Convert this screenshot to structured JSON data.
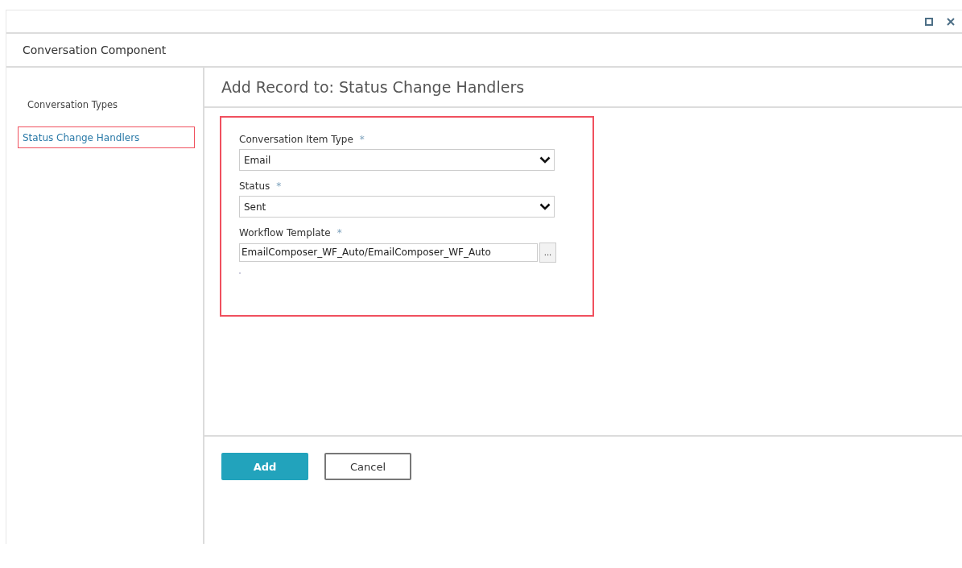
{
  "window": {
    "title": "Conversation Component"
  },
  "sidebar": {
    "items": [
      {
        "label": "Conversation Types",
        "selected": false,
        "highlighted": false
      },
      {
        "label": "Status Change Handlers",
        "selected": true,
        "highlighted": true
      }
    ]
  },
  "form": {
    "title": "Add Record to: Status Change Handlers",
    "highlighted": true,
    "fields": [
      {
        "kind": "select",
        "label": "Conversation Item Type",
        "required": "*",
        "value": "Email"
      },
      {
        "kind": "select",
        "label": "Status",
        "required": "*",
        "value": "Sent"
      },
      {
        "kind": "picker",
        "label": "Workflow Template",
        "required": "*",
        "value": "EmailComposer_WF_Auto/EmailComposer_WF_Auto",
        "button": "..."
      }
    ]
  },
  "buttons": [
    {
      "kind": "primary",
      "label": "Add"
    },
    {
      "kind": "secondary",
      "label": "Cancel"
    }
  ]
}
